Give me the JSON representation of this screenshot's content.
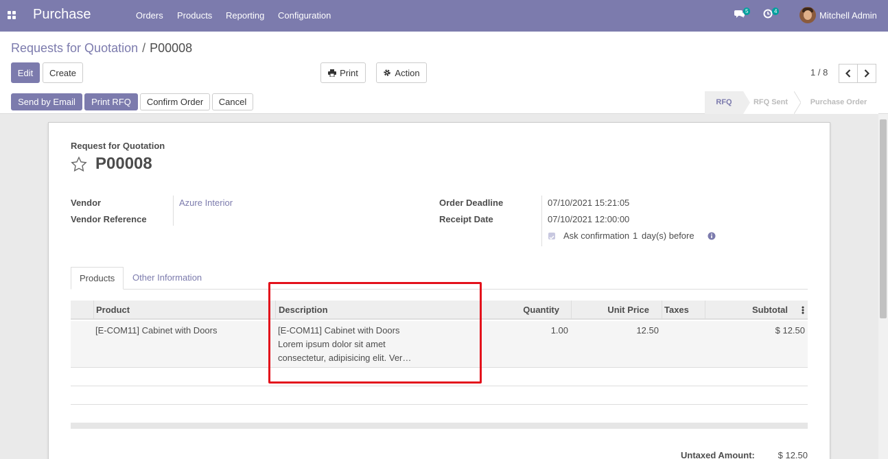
{
  "navbar": {
    "app_name": "Purchase",
    "menu": [
      "Orders",
      "Products",
      "Reporting",
      "Configuration"
    ],
    "messages_count": "5",
    "activities_count": "4",
    "user_name": "Mitchell Admin"
  },
  "breadcrumb": {
    "parent": "Requests for Quotation",
    "separator": "/",
    "current": "P00008"
  },
  "buttons": {
    "edit": "Edit",
    "create": "Create",
    "print": "Print",
    "action": "Action",
    "send_by_email": "Send by Email",
    "print_rfq": "Print RFQ",
    "confirm_order": "Confirm Order",
    "cancel": "Cancel"
  },
  "pager": {
    "text": "1 / 8"
  },
  "statusbar": [
    "RFQ",
    "RFQ Sent",
    "Purchase Order"
  ],
  "form": {
    "doc_type": "Request for Quotation",
    "name": "P00008",
    "vendor_label": "Vendor",
    "vendor_value": "Azure Interior",
    "vendor_ref_label": "Vendor Reference",
    "vendor_ref_value": "",
    "order_deadline_label": "Order Deadline",
    "order_deadline_value": "07/10/2021 15:21:05",
    "receipt_date_label": "Receipt Date",
    "receipt_date_value": "07/10/2021 12:00:00",
    "ask_confirmation_label": "Ask confirmation",
    "ask_confirmation_days": "1",
    "ask_confirmation_suffix": "day(s) before"
  },
  "tabs": [
    "Products",
    "Other Information"
  ],
  "table": {
    "headers": [
      "Product",
      "Description",
      "Quantity",
      "Unit Price",
      "Taxes",
      "Subtotal"
    ],
    "rows": [
      {
        "product": "[E-COM11] Cabinet with Doors",
        "description_lines": [
          "[E-COM11] Cabinet with Doors",
          "Lorem ipsum dolor sit amet",
          "consectetur, adipisicing elit. Ver…"
        ],
        "quantity": "1.00",
        "unit_price": "12.50",
        "taxes": "",
        "subtotal": "$ 12.50"
      }
    ]
  },
  "totals": {
    "untaxed_label": "Untaxed Amount:",
    "untaxed_value": "$ 12.50"
  },
  "colors": {
    "brand": "#7c7bad",
    "highlight": "#e3101b"
  }
}
